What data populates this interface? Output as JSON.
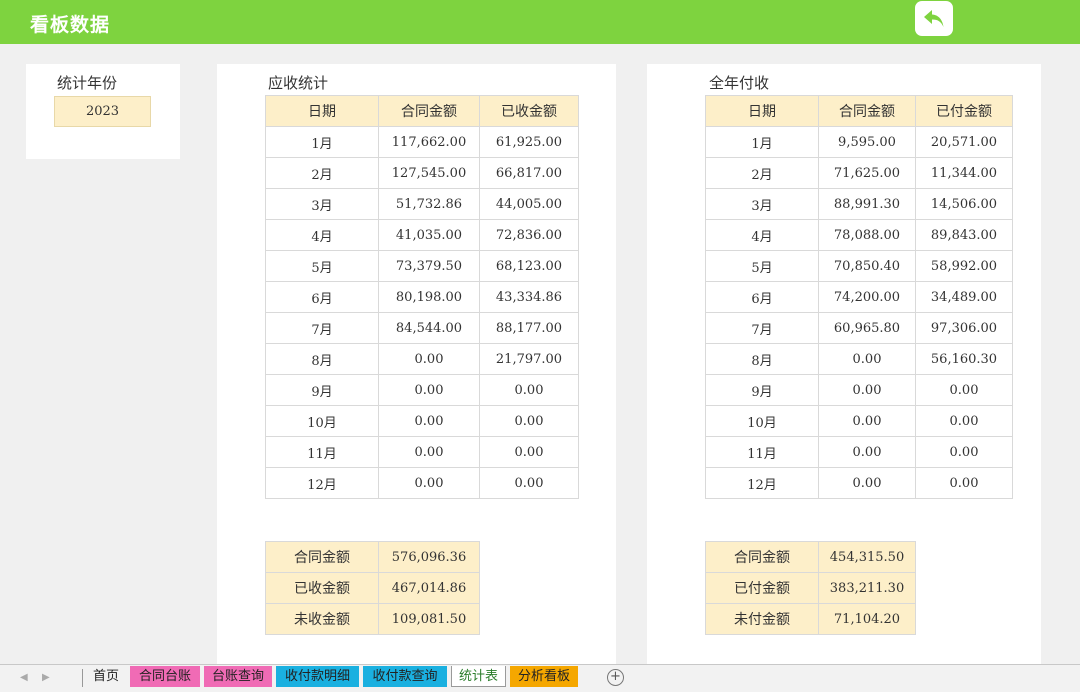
{
  "header": {
    "title": "看板数据"
  },
  "year_panel": {
    "label": "统计年份",
    "value": "2023"
  },
  "receivable": {
    "title": "应收统计",
    "columns": [
      "日期",
      "合同金额",
      "已收金额"
    ],
    "rows": [
      [
        "1月",
        "117,662.00",
        "61,925.00"
      ],
      [
        "2月",
        "127,545.00",
        "66,817.00"
      ],
      [
        "3月",
        "51,732.86",
        "44,005.00"
      ],
      [
        "4月",
        "41,035.00",
        "72,836.00"
      ],
      [
        "5月",
        "73,379.50",
        "68,123.00"
      ],
      [
        "6月",
        "80,198.00",
        "43,334.86"
      ],
      [
        "7月",
        "84,544.00",
        "88,177.00"
      ],
      [
        "8月",
        "0.00",
        "21,797.00"
      ],
      [
        "9月",
        "0.00",
        "0.00"
      ],
      [
        "10月",
        "0.00",
        "0.00"
      ],
      [
        "11月",
        "0.00",
        "0.00"
      ],
      [
        "12月",
        "0.00",
        "0.00"
      ]
    ],
    "summary": [
      [
        "合同金额",
        "576,096.36"
      ],
      [
        "已收金额",
        "467,014.86"
      ],
      [
        "未收金额",
        "109,081.50"
      ]
    ]
  },
  "payable": {
    "title": "全年付收",
    "columns": [
      "日期",
      "合同金额",
      "已付金额"
    ],
    "rows": [
      [
        "1月",
        "9,595.00",
        "20,571.00"
      ],
      [
        "2月",
        "71,625.00",
        "11,344.00"
      ],
      [
        "3月",
        "88,991.30",
        "14,506.00"
      ],
      [
        "4月",
        "78,088.00",
        "89,843.00"
      ],
      [
        "5月",
        "70,850.40",
        "58,992.00"
      ],
      [
        "6月",
        "74,200.00",
        "34,489.00"
      ],
      [
        "7月",
        "60,965.80",
        "97,306.00"
      ],
      [
        "8月",
        "0.00",
        "56,160.30"
      ],
      [
        "9月",
        "0.00",
        "0.00"
      ],
      [
        "10月",
        "0.00",
        "0.00"
      ],
      [
        "11月",
        "0.00",
        "0.00"
      ],
      [
        "12月",
        "0.00",
        "0.00"
      ]
    ],
    "summary": [
      [
        "合同金额",
        "454,315.50"
      ],
      [
        "已付金额",
        "383,211.30"
      ],
      [
        "未付金额",
        "71,104.20"
      ]
    ]
  },
  "sheet_tabs": [
    {
      "label": "首页",
      "color": "#f2f2f2"
    },
    {
      "label": "合同台账",
      "color": "#f06bb5"
    },
    {
      "label": "台账查询",
      "color": "#f06bb5"
    },
    {
      "label": "收付款明细",
      "color": "#1ab0e0"
    },
    {
      "label": "收付款查询",
      "color": "#1ab0e0"
    },
    {
      "label": "统计表",
      "color": "#ffffff"
    },
    {
      "label": "分析看板",
      "color": "#f5a700"
    }
  ],
  "colors": {
    "header_bg": "#7ed33f",
    "cell_highlight": "#fdefc9"
  },
  "icons": {
    "back": "back-arrow-icon",
    "add_sheet": "plus-circle-icon"
  }
}
